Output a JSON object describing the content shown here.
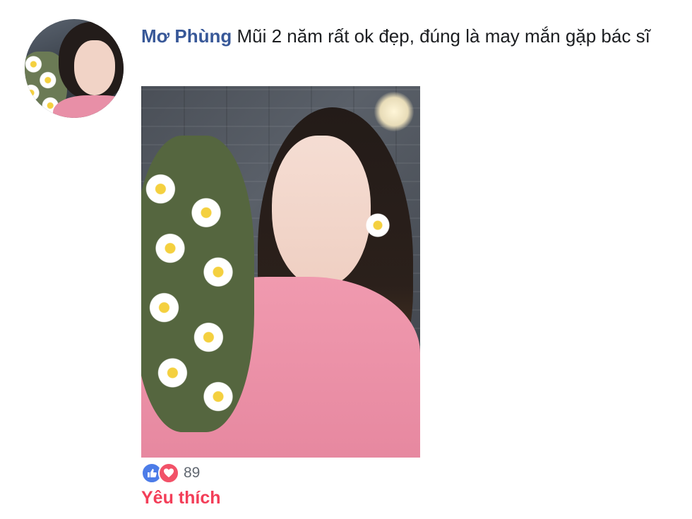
{
  "comment": {
    "author": "Mơ Phùng",
    "text": "Mũi 2 năm rất ok đẹp, đúng là may mắn gặp bác sĩ"
  },
  "reactions": {
    "icons": [
      "thumbs-up-icon",
      "heart-icon"
    ],
    "count": "89",
    "active_label": "Yêu thích"
  },
  "colors": {
    "author_link": "#385898",
    "like_blue": "#4c7ce8",
    "love_red": "#f25268",
    "yeu_thich": "#f33e58"
  }
}
